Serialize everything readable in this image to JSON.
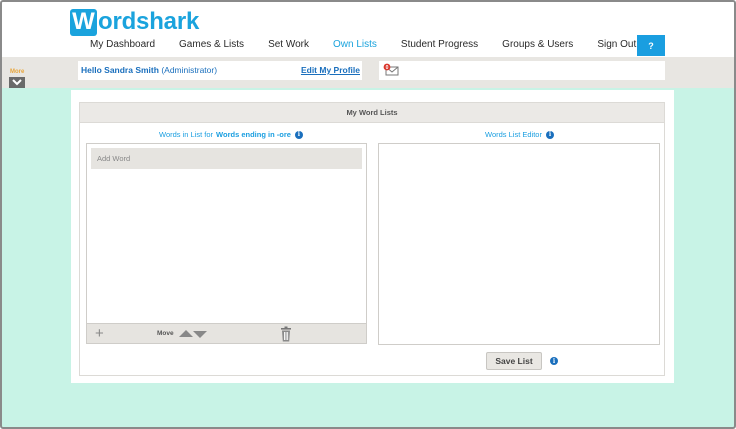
{
  "app": {
    "logo_first_letter": "W",
    "logo_rest": "ordshark",
    "brand_color": "#1aa3dd"
  },
  "nav": {
    "items": [
      {
        "label": "My Dashboard",
        "active": false
      },
      {
        "label": "Games & Lists",
        "active": false
      },
      {
        "label": "Set Work",
        "active": false
      },
      {
        "label": "Own Lists",
        "active": true
      },
      {
        "label": "Student Progress",
        "active": false
      },
      {
        "label": "Groups & Users",
        "active": false
      },
      {
        "label": "Sign Out",
        "active": false
      }
    ],
    "help_label": "?"
  },
  "userbar": {
    "more_label": "More",
    "hello_prefix": "Hello",
    "user_name": "Sandra Smith",
    "role": "(Administrator)",
    "edit_profile": "Edit My Profile",
    "message_count": "0"
  },
  "panel": {
    "title": "My Word Lists",
    "list_title_prefix": "Words in List for",
    "list_name": "Words ending in -ore",
    "editor_title": "Words List Editor",
    "add_word_placeholder": "Add Word",
    "move_label": "Move",
    "save_label": "Save List"
  },
  "icons": {
    "more": "chevron-down-icon",
    "mail": "mail-icon",
    "info": "info-icon",
    "add": "plus-icon",
    "up": "arrow-up-icon",
    "down": "arrow-down-icon",
    "delete": "trash-icon"
  }
}
